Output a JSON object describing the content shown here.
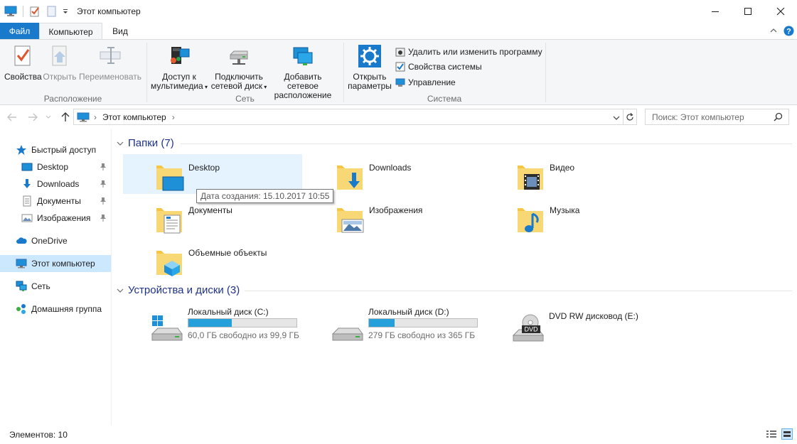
{
  "window": {
    "title": "Этот компьютер",
    "minimize": "—",
    "maximize": "☐",
    "close": "✕"
  },
  "ribbon": {
    "tabs": [
      {
        "label": "Файл"
      },
      {
        "label": "Компьютер"
      },
      {
        "label": "Вид"
      }
    ],
    "groups": {
      "location": {
        "label": "Расположение",
        "properties": "Свойства",
        "open": "Открыть",
        "rename": "Переименовать"
      },
      "network": {
        "label": "Сеть",
        "media_line1": "Доступ к",
        "media_line2": "мультимедиа",
        "map_line1": "Подключить",
        "map_line2": "сетевой диск",
        "add_line1": "Добавить сетевое",
        "add_line2": "расположение"
      },
      "system": {
        "label": "Система",
        "settings_line1": "Открыть",
        "settings_line2": "параметры",
        "uninstall": "Удалить или изменить программу",
        "sys_props": "Свойства системы",
        "manage": "Управление"
      }
    }
  },
  "address": {
    "path": "Этот компьютер",
    "search_placeholder": "Поиск: Этот компьютер"
  },
  "navpane": {
    "items": [
      {
        "label": "Быстрый доступ",
        "icon": "star-icon"
      },
      {
        "label": "Desktop",
        "icon": "desktop-icon"
      },
      {
        "label": "Downloads",
        "icon": "downloads-icon"
      },
      {
        "label": "Документы",
        "icon": "documents-icon"
      },
      {
        "label": "Изображения",
        "icon": "pictures-icon"
      },
      {
        "label": "OneDrive",
        "icon": "cloud-icon"
      },
      {
        "label": "Этот компьютер",
        "icon": "computer-icon"
      },
      {
        "label": "Сеть",
        "icon": "network-icon"
      },
      {
        "label": "Домашняя группа",
        "icon": "homegroup-icon"
      }
    ]
  },
  "content": {
    "folders_header": "Папки (7)",
    "devices_header": "Устройства и диски (3)",
    "folders": [
      {
        "name": "Desktop"
      },
      {
        "name": "Downloads"
      },
      {
        "name": "Видео"
      },
      {
        "name": "Документы"
      },
      {
        "name": "Изображения"
      },
      {
        "name": "Музыка"
      },
      {
        "name": "Объемные объекты"
      }
    ],
    "drives": [
      {
        "name": "Локальный диск (C:)",
        "free": "60,0 ГБ свободно из 99,9 ГБ",
        "used_fraction": 0.4
      },
      {
        "name": "Локальный диск (D:)",
        "free": "279 ГБ свободно из 365 ГБ",
        "used_fraction": 0.24
      },
      {
        "name": "DVD RW дисковод (E:)",
        "dvd_label": "DVD"
      }
    ],
    "tooltip": "Дата создания: 15.10.2017 10:55"
  },
  "status": {
    "items": "Элементов: 10"
  },
  "colors": {
    "accent": "#1979ca",
    "selection": "#cce8ff",
    "hover": "#e5f3ff",
    "drive_bar": "#26a0da",
    "folder": "#f5c543"
  }
}
